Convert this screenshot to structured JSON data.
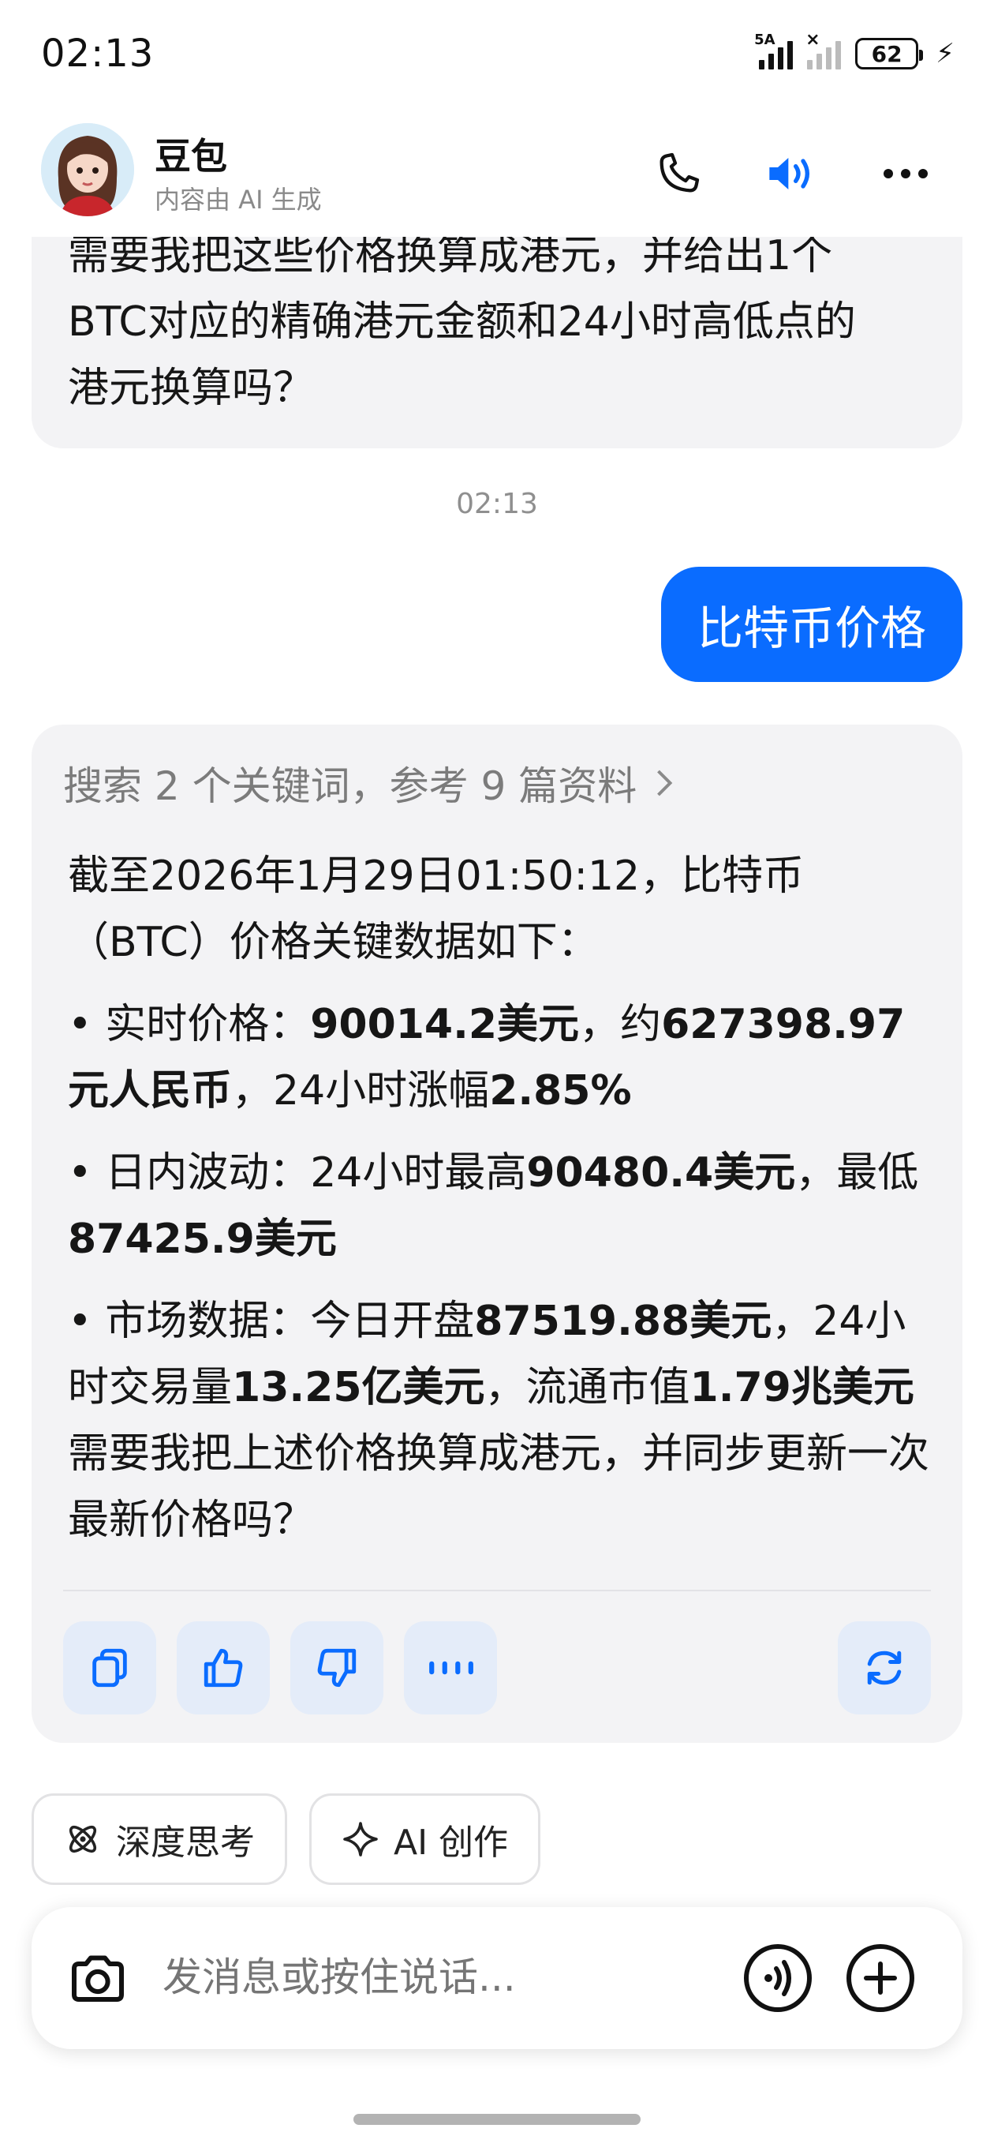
{
  "status": {
    "time": "02:13",
    "network_tag": "5A",
    "battery": "62"
  },
  "header": {
    "name": "豆包",
    "subtitle": "内容由 AI 生成"
  },
  "prev_message": {
    "lines": [
      "需要我把这些价格换算成港元，并给出1个",
      "BTC对应的精确港元金额和24小时高低点的",
      "港元换算吗？"
    ]
  },
  "timestamp": "02:13",
  "user_message": "比特币价格",
  "answer": {
    "search_ref": "搜索 2 个关键词，参考 9 篇资料",
    "intro": "截至2026年1月29日01:50:12，比特币（BTC）价格关键数据如下：",
    "b1_prefix": "• 实时价格：",
    "b1_val1": "90014.2美元",
    "b1_mid": "，约",
    "b1_val2": "627398.97元人民币",
    "b1_mid2": "，24小时涨幅",
    "b1_val3": "2.85%",
    "b2_prefix": "• 日内波动：24小时最高",
    "b2_val1": "90480.4美元",
    "b2_mid": "，最低",
    "b2_val2": "87425.9美元",
    "b3_prefix": "• 市场数据：今日开盘",
    "b3_val1": "87519.88美元",
    "b3_mid": "，24小时交易量",
    "b3_val2": "13.25亿美元",
    "b3_mid2": "，流通市值",
    "b3_val3": "1.79兆美元",
    "closing": "需要我把上述价格换算成港元，并同步更新一次最新价格吗？"
  },
  "chips": {
    "deep_think": "深度思考",
    "ai_create": "AI 创作"
  },
  "input": {
    "placeholder": "发消息或按住说话..."
  },
  "colors": {
    "accent": "#0a6cff",
    "bubble_bg": "#f3f3f5",
    "action_bg": "#e4ecf9"
  }
}
